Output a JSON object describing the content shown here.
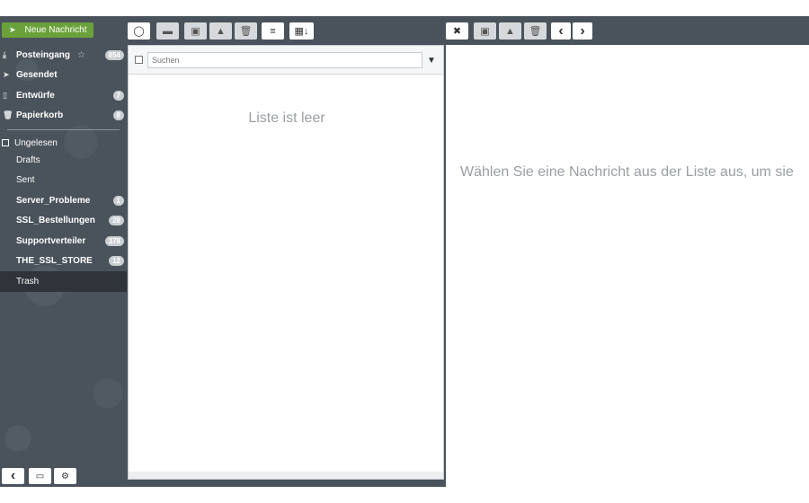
{
  "compose_button": {
    "label": "Neue Nachricht"
  },
  "toolbar_list": {
    "refresh_icon": "◯",
    "mark_icon": "▬",
    "archive_icon": "▣",
    "spam_icon": "▲",
    "delete_icon": "🗑",
    "menu_icon": "≡",
    "sort_icon": "▦↓"
  },
  "toolbar_message": {
    "close_icon": "✖",
    "archive_icon": "▣",
    "spam_icon": "▲",
    "delete_icon": "🗑",
    "prev_icon": "‹",
    "next_icon": "›"
  },
  "sidebar": {
    "folders": [
      {
        "label": "Posteingang",
        "icon": "⤓",
        "badge": "854",
        "star": "☆",
        "bold": true
      },
      {
        "label": "Gesendet",
        "icon": "➤",
        "badge": "",
        "bold": true
      },
      {
        "label": "Entwürfe",
        "icon": "▯",
        "badge": "7",
        "bold": true
      },
      {
        "label": "Papierkorb",
        "icon": "🗑",
        "badge": "8",
        "bold": true
      }
    ],
    "unread_label": "Ungelesen",
    "custom_folders": [
      {
        "label": "Drafts",
        "badge": ""
      },
      {
        "label": "Sent",
        "badge": ""
      },
      {
        "label": "Server_Probleme",
        "badge": "1"
      },
      {
        "label": "SSL_Bestellungen",
        "badge": "28"
      },
      {
        "label": "Supportverteiler",
        "badge": "378"
      },
      {
        "label": "THE_SSL_STORE",
        "badge": "12"
      },
      {
        "label": "Trash",
        "badge": ""
      }
    ],
    "bottom": {
      "collapse_icon": "‹",
      "folders_icon": "▭",
      "settings_icon": "⚙"
    }
  },
  "list": {
    "search_placeholder": "Suchen",
    "dropdown_icon": "▼",
    "empty_text": "Liste ist leer"
  },
  "message": {
    "hint": "Wählen Sie eine Nachricht aus der Liste aus, um sie"
  },
  "colors": {
    "accent": "#6aa13a",
    "sidebar_bg": "#4a535c",
    "active_bg": "#2e343a"
  }
}
